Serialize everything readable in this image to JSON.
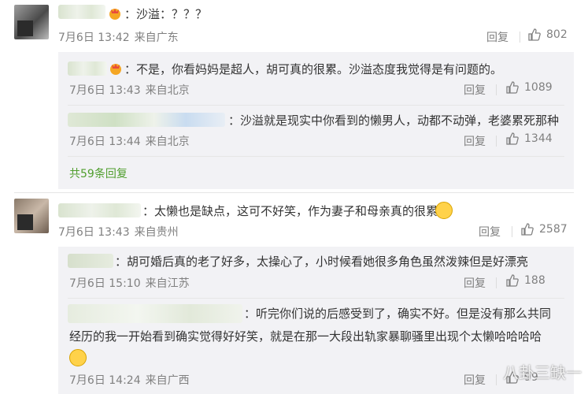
{
  "comments": [
    {
      "text": "：沙溢：？？？",
      "date": "7月6日 13:42",
      "source": "来自广东",
      "reply_label": "回复",
      "likes": "802",
      "replies": [
        {
          "text": "：不是，你看妈妈是超人，胡可真的很累。沙溢态度我觉得是有问题的。",
          "date": "7月6日 13:43",
          "source": "来自北京",
          "reply_label": "回复",
          "likes": "1089"
        },
        {
          "text": "：沙溢就是现实中你看到的懒男人，动都不动弹，老婆累死那种",
          "date": "7月6日 13:44",
          "source": "来自北京",
          "reply_label": "回复",
          "likes": "1344"
        }
      ],
      "more_replies": "共59条回复"
    },
    {
      "text": "：太懒也是缺点，这可不好笑，作为妻子和母亲真的很累",
      "date": "7月6日 13:43",
      "source": "来自贵州",
      "reply_label": "回复",
      "likes": "2587",
      "replies": [
        {
          "text": "：胡可婚后真的老了好多，太操心了，小时候看她很多角色虽然泼辣但是好漂亮",
          "date": "7月6日 15:10",
          "source": "来自江苏",
          "reply_label": "回复",
          "likes": "188"
        },
        {
          "text_line1": "：听完你们说的后感受到了，确实不好。但是没有那么共同",
          "text_line2": "经历的我一开始看到确实觉得好好笑，就是在那一大段出轨家暴聊骚里出现个太懒哈哈哈哈",
          "date": "7月6日 14:24",
          "source": "来自广西",
          "reply_label": "回复",
          "likes": "99"
        }
      ]
    }
  ],
  "watermark": "八卦三缺一",
  "icons": {
    "like": "thumbs-up-icon",
    "vip": "vip-badge-icon",
    "emoji": "emoji-icon"
  },
  "colors": {
    "link": "#4f9e2d",
    "meta": "#808080",
    "reply_bg": "#f2f2f5"
  }
}
